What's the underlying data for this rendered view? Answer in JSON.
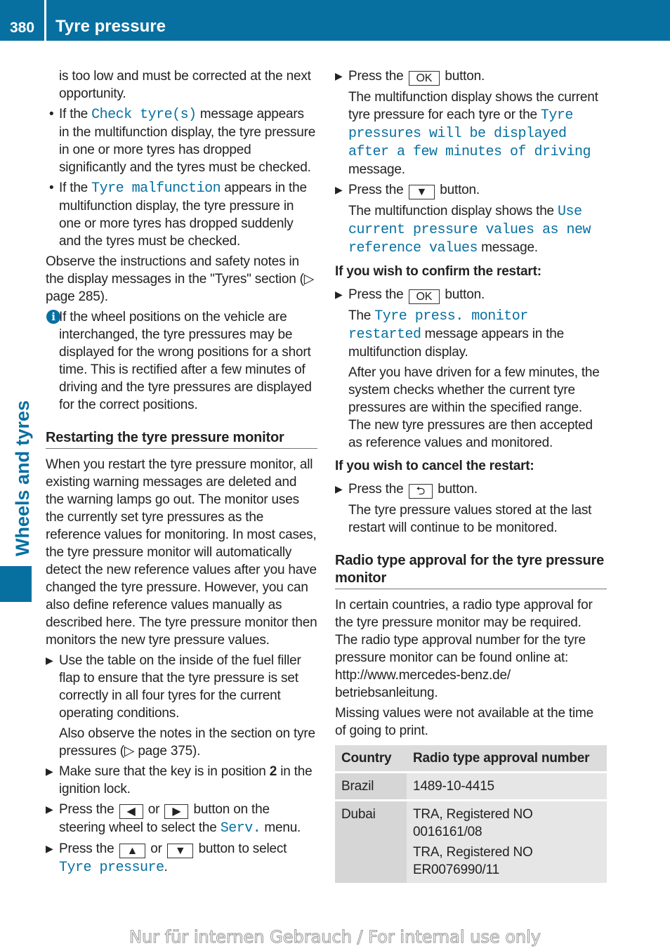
{
  "header": {
    "page_number": "380",
    "title": "Tyre pressure"
  },
  "side_tab": "Wheels and tyres",
  "footer": "Nur für internen Gebrauch / For internal use only",
  "colors": {
    "brand": "#0770a1"
  },
  "left": [
    {
      "type": "cont",
      "parts": [
        {
          "t": "is too low and must be corrected at the next opportunity."
        }
      ]
    },
    {
      "type": "bullet",
      "parts": [
        {
          "t": "If the "
        },
        {
          "c": "Check tyre(s)"
        },
        {
          "t": " message appears in the multifunction display, the tyre pressure in one or more tyres has dropped significantly and the tyres must be checked."
        }
      ]
    },
    {
      "type": "bullet",
      "parts": [
        {
          "t": "If the "
        },
        {
          "c": "Tyre malfunction"
        },
        {
          "t": " appears in the multifunction display, the tyre pressure in one or more tyres has dropped suddenly and the tyres must be checked."
        }
      ]
    },
    {
      "type": "p",
      "parts": [
        {
          "t": "Observe the instructions and safety notes in the display messages in the \"Tyres\" section (▷ page 285)."
        }
      ]
    },
    {
      "type": "info",
      "parts": [
        {
          "t": "If the wheel positions on the vehicle are interchanged, the tyre pressures may be displayed for the wrong positions for a short time. This is rectified after a few minutes of driving and the tyre pressures are displayed for the correct positions."
        }
      ]
    },
    {
      "type": "h2",
      "parts": [
        {
          "t": "Restarting the tyre pressure monitor"
        }
      ]
    },
    {
      "type": "p",
      "parts": [
        {
          "t": "When you restart the tyre pressure monitor, all existing warning messages are deleted and the warning lamps go out. The monitor uses the currently set tyre pressures as the reference values for monitoring. In most cases, the tyre pressure monitor will automatically detect the new reference values after you have changed the tyre pressure. However, you can also define reference values manually as described here. The tyre pressure monitor then monitors the new tyre pressure values."
        }
      ]
    },
    {
      "type": "arrow",
      "parts": [
        {
          "t": "Use the table on the inside of the fuel filler flap to ensure that the tyre pressure is set correctly in all four tyres for the current operating conditions."
        }
      ]
    },
    {
      "type": "cont",
      "parts": [
        {
          "t": "Also observe the notes in the section on tyre pressures (▷ page 375)."
        }
      ]
    },
    {
      "type": "arrow",
      "parts": [
        {
          "t": "Make sure that the key is in position "
        },
        {
          "b": "2"
        },
        {
          "t": " in the ignition lock."
        }
      ]
    },
    {
      "type": "arrow",
      "parts": [
        {
          "t": "Press the "
        },
        {
          "k": "◀"
        },
        {
          "t": " or "
        },
        {
          "k": "▶"
        },
        {
          "t": " button on the steering wheel to select the "
        },
        {
          "c": "Serv."
        },
        {
          "t": " menu."
        }
      ]
    },
    {
      "type": "arrow",
      "parts": [
        {
          "t": "Press the "
        },
        {
          "k": "▲"
        },
        {
          "t": " or "
        },
        {
          "k": "▼"
        },
        {
          "t": " button to select "
        },
        {
          "c": "Tyre pressure"
        },
        {
          "t": "."
        }
      ]
    }
  ],
  "right": [
    {
      "type": "arrow",
      "parts": [
        {
          "t": "Press the "
        },
        {
          "k": "OK"
        },
        {
          "t": " button."
        }
      ]
    },
    {
      "type": "cont",
      "parts": [
        {
          "t": "The multifunction display shows the current tyre pressure for each tyre or the "
        },
        {
          "c": "Tyre pressures will be displayed after a few minutes of driving"
        },
        {
          "t": " message."
        }
      ]
    },
    {
      "type": "arrow",
      "parts": [
        {
          "t": "Press the "
        },
        {
          "k": "▼"
        },
        {
          "t": " button."
        }
      ]
    },
    {
      "type": "cont",
      "parts": [
        {
          "t": "The multifunction display shows the "
        },
        {
          "c": "Use current pressure values as new reference values"
        },
        {
          "t": " message."
        }
      ]
    },
    {
      "type": "h3",
      "parts": [
        {
          "t": "If you wish to confirm the restart:"
        }
      ]
    },
    {
      "type": "arrow",
      "parts": [
        {
          "t": "Press the "
        },
        {
          "k": "OK"
        },
        {
          "t": " button."
        }
      ]
    },
    {
      "type": "cont",
      "parts": [
        {
          "t": "The "
        },
        {
          "c": "Tyre press. monitor restarted"
        },
        {
          "t": " message appears in the multifunction display."
        }
      ]
    },
    {
      "type": "cont",
      "parts": [
        {
          "t": "After you have driven for a few minutes, the system checks whether the current tyre pressures are within the specified range. The new tyre pressures are then accepted as reference values and monitored."
        }
      ]
    },
    {
      "type": "h3",
      "parts": [
        {
          "t": "If you wish to cancel the restart:"
        }
      ]
    },
    {
      "type": "arrow",
      "parts": [
        {
          "t": "Press the "
        },
        {
          "k": "⮌"
        },
        {
          "t": " button."
        }
      ]
    },
    {
      "type": "cont",
      "parts": [
        {
          "t": "The tyre pressure values stored at the last restart will continue to be monitored."
        }
      ]
    },
    {
      "type": "h2",
      "parts": [
        {
          "t": "Radio type approval for the tyre pressure monitor"
        }
      ]
    },
    {
      "type": "p",
      "parts": [
        {
          "t": "In certain countries, a radio type approval for the tyre pressure monitor may be required. The radio type approval number for the tyre pressure monitor can be found online at: http://www.mercedes-benz.de/ betriebsanleitung."
        }
      ]
    },
    {
      "type": "p",
      "parts": [
        {
          "t": "Missing values were not available at the time of going to print."
        }
      ]
    }
  ],
  "table": {
    "headers": [
      "Country",
      "Radio type approval number"
    ],
    "rows": [
      {
        "country": "Brazil",
        "numbers": [
          "1489-10-4415"
        ]
      },
      {
        "country": "Dubai",
        "numbers": [
          "TRA, Registered NO 0016161/08",
          "TRA, Registered NO ER0076990/11"
        ]
      }
    ]
  }
}
